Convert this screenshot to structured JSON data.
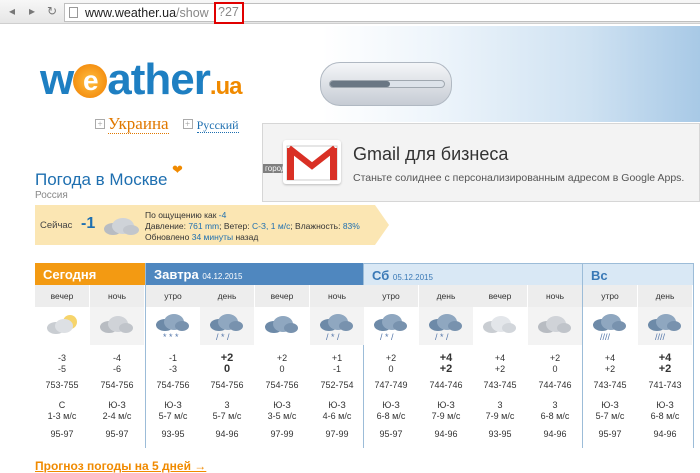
{
  "browser": {
    "url_host": "www.weather.ua",
    "url_path": "/show",
    "url_highlight": "?27"
  },
  "logo": {
    "pre": "w",
    "e": "e",
    "post": "ather",
    "domain": ".ua"
  },
  "langs": {
    "ukraine": "Украина",
    "russian": "Русский"
  },
  "ad": {
    "title": "Gmail для бизнеса",
    "subtitle": "Станьте солиднее с персонализированным адресом в Google Apps.",
    "overlay": "городом"
  },
  "city": {
    "title": "Погода в Москве",
    "country": "Россия"
  },
  "now": {
    "label": "Сейчас",
    "temp": "-1",
    "feels_prefix": "По ощущению как",
    "feels": "-4",
    "pressure_prefix": "Давление:",
    "pressure": "761 mm",
    "wind_prefix": "; Ветер:",
    "wind": "С-З, 1 м/с",
    "humidity_prefix": "; Влажность:",
    "humidity": "83%",
    "updated_prefix": "Обновлено",
    "updated": "34 минуты",
    "updated_suffix": "назад"
  },
  "days": [
    {
      "name": "Сегодня",
      "date": ""
    },
    {
      "name": "Завтра",
      "date": "04.12.2015"
    },
    {
      "name": "Сб",
      "date": "05.12.2015"
    },
    {
      "name": "Вс",
      "date": ""
    }
  ],
  "columns": [
    {
      "period": "вечер",
      "icon": "partly-cloudy-night-icon",
      "t1": "-3",
      "t2": "-5",
      "bold": false,
      "pressure": "753-755",
      "wind_dir": "С",
      "wind_speed": "1-3 м/с",
      "humidity": "95-97"
    },
    {
      "period": "ночь",
      "icon": "cloudy-night-icon",
      "t1": "-4",
      "t2": "-6",
      "bold": false,
      "pressure": "754-756",
      "wind_dir": "Ю-З",
      "wind_speed": "2-4 м/с",
      "humidity": "95-97"
    },
    {
      "period": "утро",
      "icon": "cloud-snow-icon",
      "t1": "-1",
      "t2": "-3",
      "bold": false,
      "pressure": "754-756",
      "wind_dir": "Ю-З",
      "wind_speed": "5-7 м/с",
      "humidity": "93-95"
    },
    {
      "period": "день",
      "icon": "cloud-sleet-icon",
      "t1": "+2",
      "t2": "0",
      "bold": true,
      "pressure": "754-756",
      "wind_dir": "3",
      "wind_speed": "5-7 м/с",
      "humidity": "94-96"
    },
    {
      "period": "вечер",
      "icon": "cloudy-icon",
      "t1": "+2",
      "t2": "0",
      "bold": false,
      "pressure": "754-756",
      "wind_dir": "Ю-З",
      "wind_speed": "3-5 м/с",
      "humidity": "97-99"
    },
    {
      "period": "ночь",
      "icon": "cloud-sleet-icon",
      "t1": "+1",
      "t2": "-1",
      "bold": false,
      "pressure": "752-754",
      "wind_dir": "Ю-З",
      "wind_speed": "4-6 м/с",
      "humidity": "97-99"
    },
    {
      "period": "утро",
      "icon": "cloud-sleet-icon",
      "t1": "+2",
      "t2": "0",
      "bold": false,
      "pressure": "747-749",
      "wind_dir": "Ю-З",
      "wind_speed": "6-8 м/с",
      "humidity": "95-97"
    },
    {
      "period": "день",
      "icon": "cloud-sleet-icon",
      "t1": "+4",
      "t2": "+2",
      "bold": true,
      "pressure": "744-746",
      "wind_dir": "Ю-З",
      "wind_speed": "7-9 м/с",
      "humidity": "94-96"
    },
    {
      "period": "вечер",
      "icon": "cloudy-day-icon",
      "t1": "+4",
      "t2": "+2",
      "bold": false,
      "pressure": "743-745",
      "wind_dir": "3",
      "wind_speed": "7-9 м/с",
      "humidity": "93-95"
    },
    {
      "period": "ночь",
      "icon": "cloudy-night-icon",
      "t1": "+2",
      "t2": "0",
      "bold": false,
      "pressure": "744-746",
      "wind_dir": "3",
      "wind_speed": "6-8 м/с",
      "humidity": "94-96"
    },
    {
      "period": "утро",
      "icon": "cloud-rain-icon",
      "t1": "+4",
      "t2": "+2",
      "bold": false,
      "pressure": "743-745",
      "wind_dir": "Ю-З",
      "wind_speed": "5-7 м/с",
      "humidity": "95-97"
    },
    {
      "period": "день",
      "icon": "cloud-rain-icon",
      "t1": "+4",
      "t2": "+2",
      "bold": true,
      "pressure": "741-743",
      "wind_dir": "Ю-З",
      "wind_speed": "6-8 м/с",
      "humidity": "94-96"
    }
  ],
  "forecast_link": "Прогноз погоды на 5 дней →"
}
